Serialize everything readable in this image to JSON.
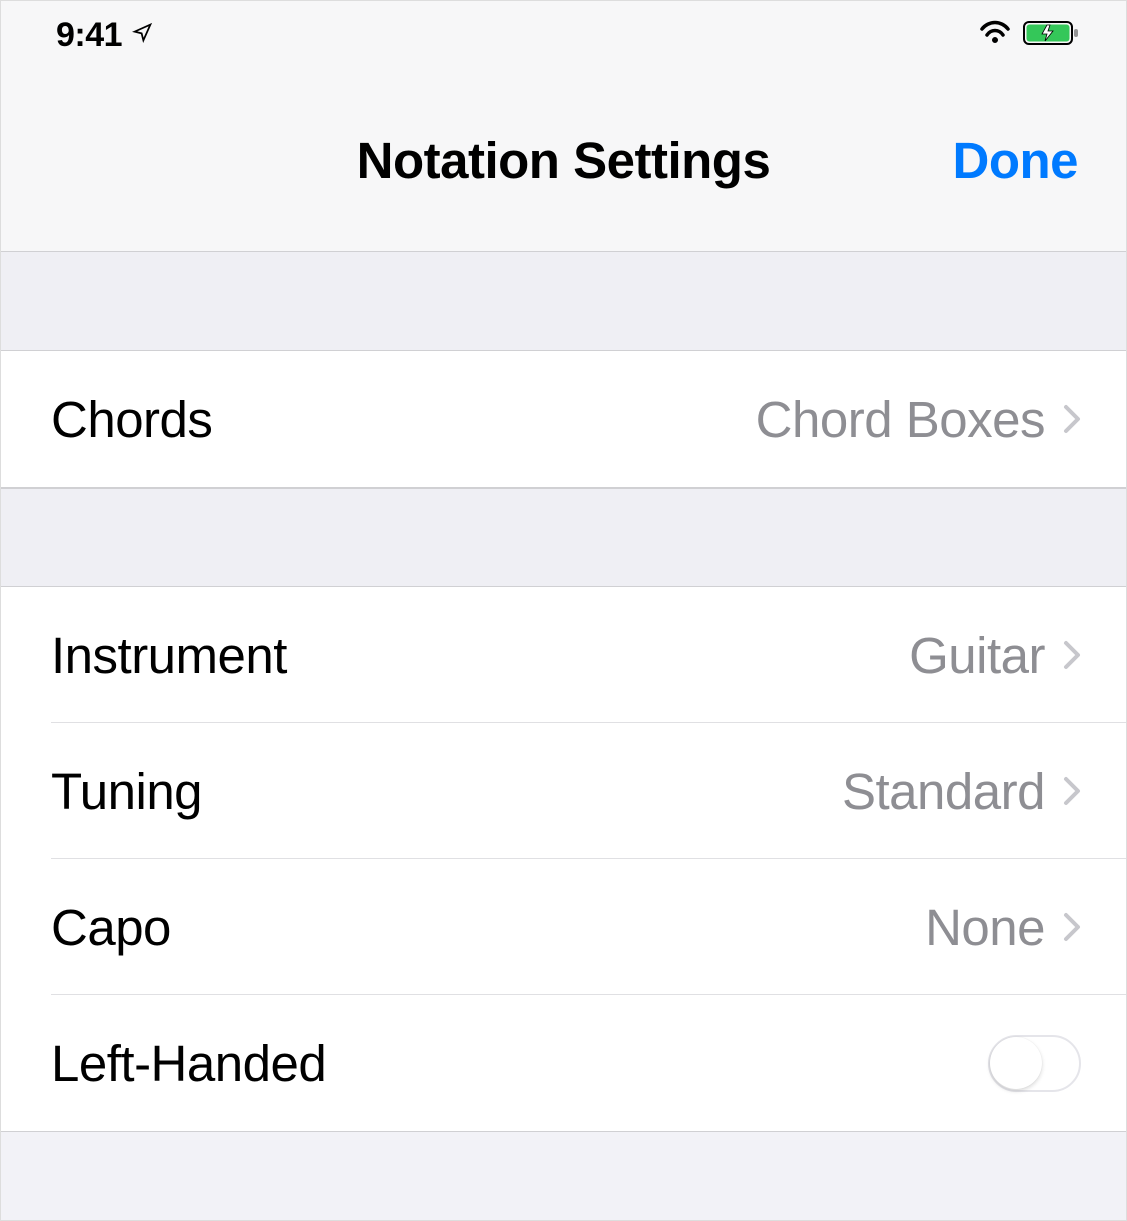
{
  "status_bar": {
    "time": "9:41"
  },
  "nav": {
    "title": "Notation Settings",
    "done": "Done"
  },
  "settings": {
    "chords": {
      "label": "Chords",
      "value": "Chord Boxes"
    },
    "instrument": {
      "label": "Instrument",
      "value": "Guitar"
    },
    "tuning": {
      "label": "Tuning",
      "value": "Standard"
    },
    "capo": {
      "label": "Capo",
      "value": "None"
    },
    "left_handed": {
      "label": "Left-Handed",
      "enabled": false
    }
  }
}
